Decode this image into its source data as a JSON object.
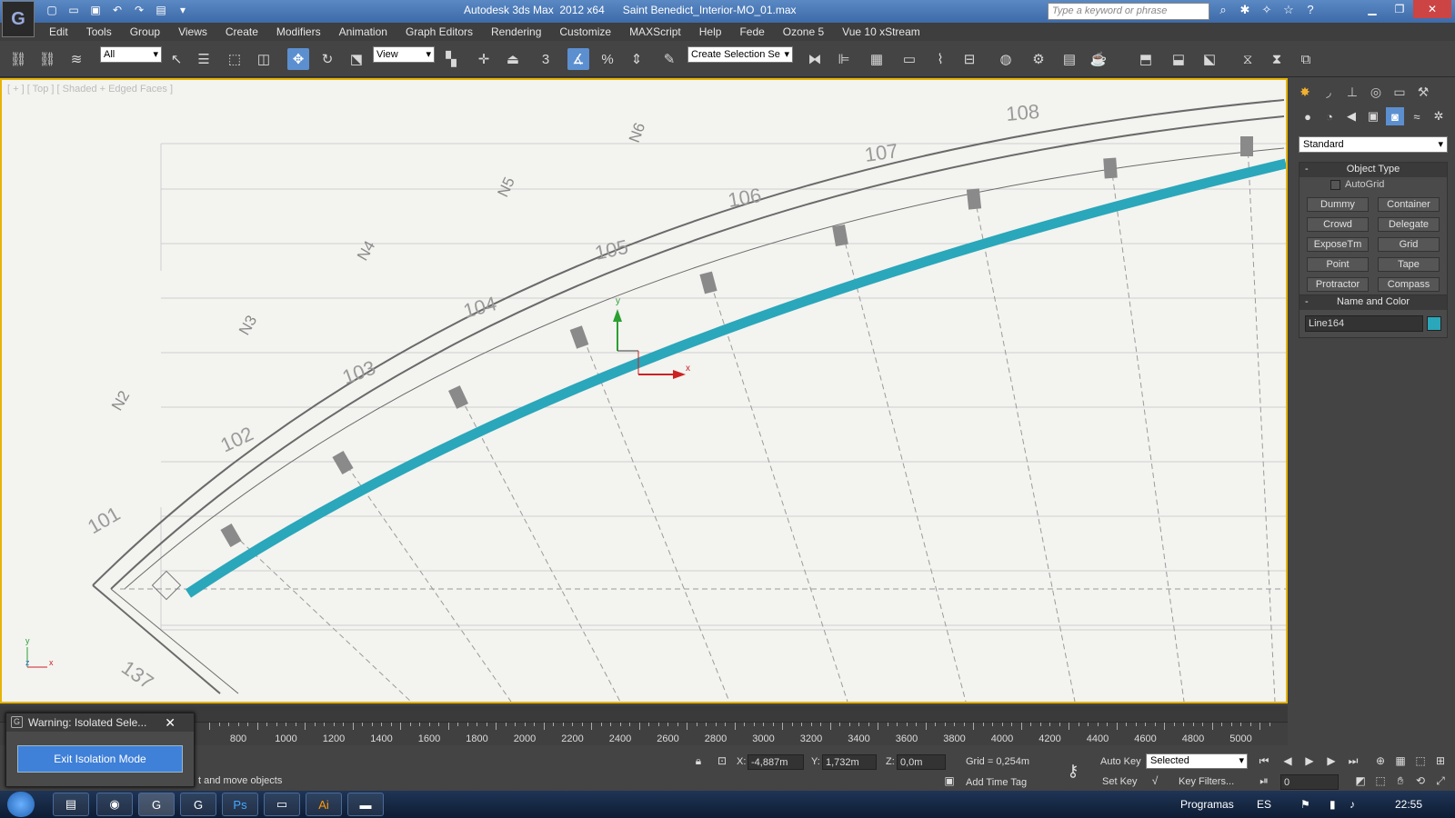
{
  "window": {
    "title": "Autodesk 3ds Max  2012 x64      Saint Benedict_Interior-MO_01.max",
    "search_placeholder": "Type a keyword or phrase"
  },
  "menu": [
    "Edit",
    "Tools",
    "Group",
    "Views",
    "Create",
    "Modifiers",
    "Animation",
    "Graph Editors",
    "Rendering",
    "Customize",
    "MAXScript",
    "Help",
    "Fede",
    "Ozone 5",
    "Vue 10 xStream"
  ],
  "toolbar": {
    "selection_filter": "All",
    "reference_coord": "View",
    "named_selection": "Create Selection Se",
    "snap_label": "3"
  },
  "viewport": {
    "label": "[ + ] [ Top ] [ Shaded + Edged Faces ]",
    "line_color": "#2aa7ba",
    "gizmo_axes": [
      "y",
      "x"
    ],
    "home_axes": [
      "y",
      "z",
      "x"
    ],
    "blueprint_numbers": [
      "101",
      "102",
      "103",
      "104",
      "105",
      "106",
      "107",
      "108"
    ],
    "blueprint_labels": [
      "N2",
      "N3",
      "N4",
      "N5",
      "N6"
    ],
    "blueprint_misc": [
      "137"
    ]
  },
  "command_panel": {
    "category": "Standard",
    "object_type_title": "Object Type",
    "autogrid_label": "AutoGrid",
    "buttons": [
      "Dummy",
      "Container",
      "Crowd",
      "Delegate",
      "ExposeTm",
      "Grid",
      "Point",
      "Tape",
      "Protractor",
      "Compass"
    ],
    "name_color_title": "Name and Color",
    "object_name": "Line164",
    "object_color": "#2aa7ba"
  },
  "trackbar": {
    "ticks": [
      "800",
      "1000",
      "1200",
      "1400",
      "1600",
      "1800",
      "2000",
      "2200",
      "2400",
      "2600",
      "2800",
      "3000",
      "3200",
      "3400",
      "3600",
      "3800",
      "4000",
      "4200",
      "4400",
      "4600",
      "4800",
      "5000"
    ]
  },
  "status": {
    "prompt": "t and move objects",
    "x_label": "X:",
    "x_value": "-4,887m",
    "y_label": "Y:",
    "y_value": "1,732m",
    "z_label": "Z:",
    "z_value": "0,0m",
    "grid": "Grid = 0,254m",
    "add_time_tag": "Add Time Tag",
    "auto_key": "Auto Key",
    "set_key": "Set Key",
    "key_mode": "Selected",
    "key_filters": "Key Filters...",
    "frame": "0"
  },
  "dialog": {
    "title": "Warning: Isolated Sele...",
    "button": "Exit Isolation Mode"
  },
  "taskbar": {
    "programs": "Programas",
    "language": "ES",
    "time": "22:55"
  }
}
